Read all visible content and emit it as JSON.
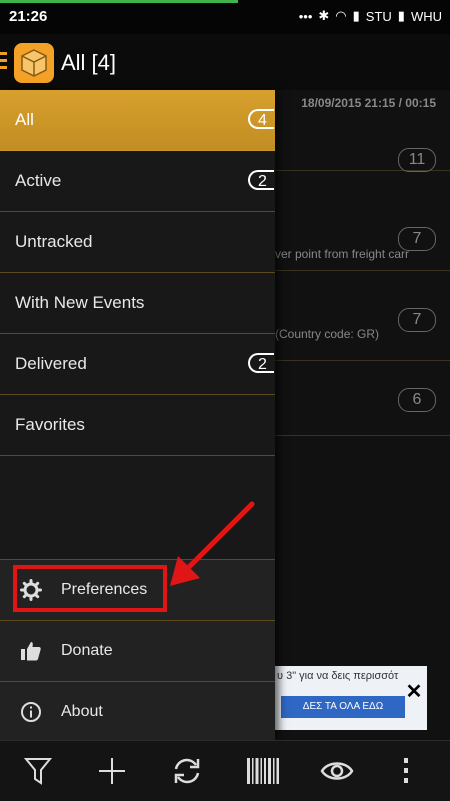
{
  "status": {
    "time": "21:26",
    "carrier1": "STU",
    "carrier2": "WHU"
  },
  "actionbar": {
    "title": "All [4]",
    "logo_icon": "package-icon",
    "menu_icon": "menu-icon"
  },
  "background_list": {
    "date": "18/09/2015 21:15 / 00:15",
    "counts": [
      "11",
      "7",
      "7",
      "6"
    ],
    "snippets": [
      "ver point from freight carr",
      "(Country code: GR)"
    ]
  },
  "drawer": {
    "items": [
      {
        "label": "All",
        "badge": "4"
      },
      {
        "label": "Active",
        "badge": "2"
      },
      {
        "label": "Untracked"
      },
      {
        "label": "With New Events"
      },
      {
        "label": "Delivered",
        "badge": "2"
      },
      {
        "label": "Favorites"
      }
    ],
    "bottom": [
      {
        "label": "Preferences",
        "icon": "gear-icon"
      },
      {
        "label": "Donate",
        "icon": "thumbs-up-icon"
      },
      {
        "label": "About",
        "icon": "info-icon"
      }
    ]
  },
  "ad": {
    "text": "υ 3\" για να δεις περισσότ",
    "button": "ΔΕΣ ΤΑ ΟΛΑ ΕΔΩ",
    "close": "✕"
  },
  "toolbar": {
    "icons": [
      "filter-icon",
      "add-icon",
      "refresh-icon",
      "barcode-icon",
      "eye-icon",
      "overflow-menu-icon"
    ]
  },
  "colors": {
    "accent": "#d7a02e",
    "highlight": "#e01616"
  }
}
